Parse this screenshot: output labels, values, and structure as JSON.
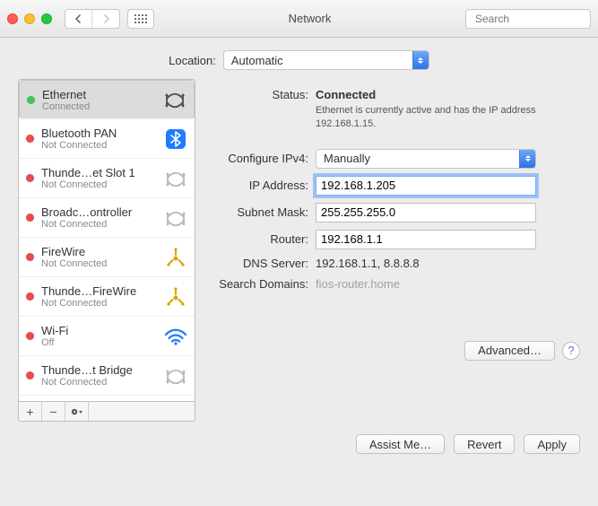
{
  "window": {
    "title": "Network"
  },
  "search": {
    "placeholder": "Search"
  },
  "location": {
    "label": "Location:",
    "value": "Automatic"
  },
  "sidebar": {
    "items": [
      {
        "name": "Ethernet",
        "status": "Connected",
        "dot": "green",
        "icon": "ethernet"
      },
      {
        "name": "Bluetooth PAN",
        "status": "Not Connected",
        "dot": "red",
        "icon": "bluetooth"
      },
      {
        "name": "Thunde…et Slot 1",
        "status": "Not Connected",
        "dot": "red",
        "icon": "ethernet"
      },
      {
        "name": "Broadc…ontroller",
        "status": "Not Connected",
        "dot": "red",
        "icon": "ethernet"
      },
      {
        "name": "FireWire",
        "status": "Not Connected",
        "dot": "red",
        "icon": "firewire"
      },
      {
        "name": "Thunde…FireWire",
        "status": "Not Connected",
        "dot": "red",
        "icon": "firewire"
      },
      {
        "name": "Wi-Fi",
        "status": "Off",
        "dot": "red",
        "icon": "wifi"
      },
      {
        "name": "Thunde…t Bridge",
        "status": "Not Connected",
        "dot": "red",
        "icon": "ethernet"
      }
    ]
  },
  "details": {
    "status_label": "Status:",
    "status_value": "Connected",
    "status_desc": "Ethernet is currently active and has the IP address 192.168.1.15.",
    "configure_label": "Configure IPv4:",
    "configure_value": "Manually",
    "ip_label": "IP Address:",
    "ip_value": "192.168.1.205",
    "mask_label": "Subnet Mask:",
    "mask_value": "255.255.255.0",
    "router_label": "Router:",
    "router_value": "192.168.1.1",
    "dns_label": "DNS Server:",
    "dns_value": "192.168.1.1, 8.8.8.8",
    "search_label": "Search Domains:",
    "search_value": "fios-router.home"
  },
  "buttons": {
    "advanced": "Advanced…",
    "assist": "Assist Me…",
    "revert": "Revert",
    "apply": "Apply"
  }
}
